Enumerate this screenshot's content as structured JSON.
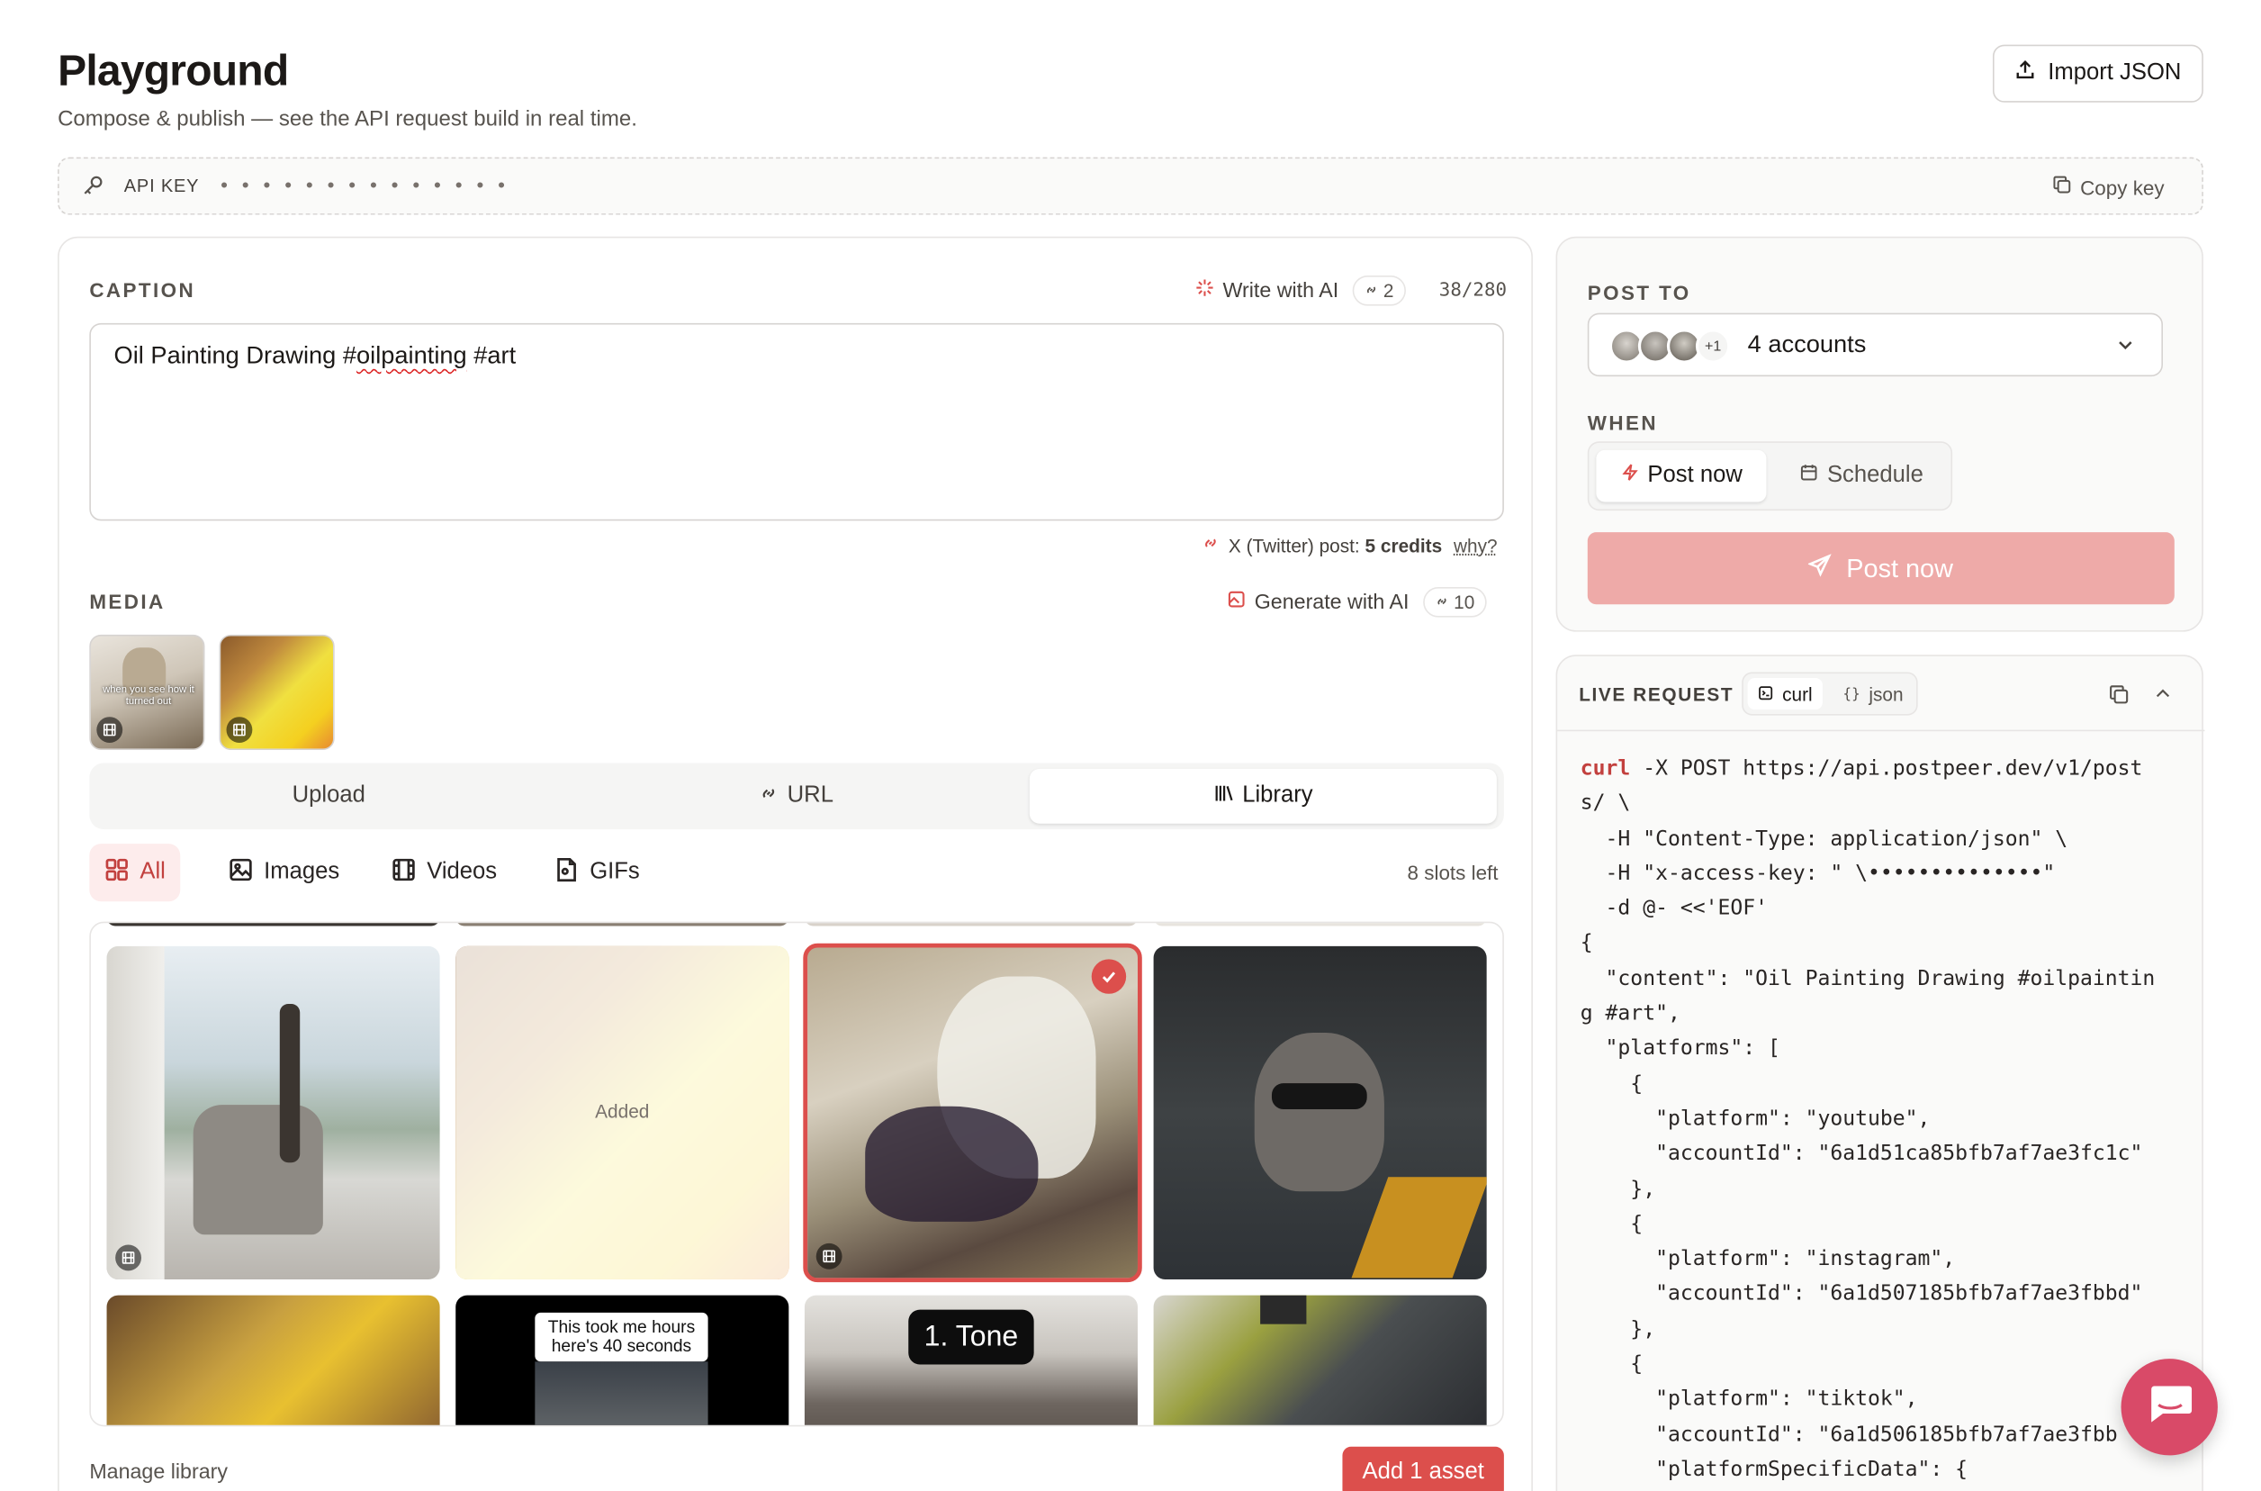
{
  "header": {
    "title": "Playground",
    "subtitle": "Compose & publish — see the API request build in real time.",
    "import_label": "Import JSON"
  },
  "api_key": {
    "label": "API KEY",
    "masked": "• • • • • • • • • • • • • •",
    "copy_label": "Copy key"
  },
  "caption": {
    "section_label": "CAPTION",
    "write_ai_label": "Write with AI",
    "write_ai_credits": "2",
    "char_count": "38/280",
    "text_before": "Oil Painting Drawing #",
    "text_misspelled": "oilpainting",
    "text_after": " #art",
    "cost_prefix": "X (Twitter) post: ",
    "cost_value": "5 credits",
    "why_label": "why?"
  },
  "media": {
    "section_label": "MEDIA",
    "generate_label": "Generate with AI",
    "generate_credits": "10",
    "attached_thumb_caption": "when you see how it turned out",
    "source_tabs": [
      "Upload",
      "URL",
      "Library"
    ],
    "filters": [
      "All",
      "Images",
      "Videos",
      "GIFs"
    ],
    "slots_left": "8 slots left",
    "added_label": "Added",
    "tile_text_1": "This took me hours here's 40 seconds",
    "tile_text_2": "1. Tone",
    "manage_label": "Manage library",
    "add_asset_label": "Add 1 asset"
  },
  "post_to": {
    "section_label": "POST TO",
    "extra_count": "+1",
    "accounts_label": "4 accounts",
    "when_label": "WHEN",
    "post_now_tab": "Post now",
    "schedule_tab": "Schedule",
    "submit_label": "Post now"
  },
  "live_request": {
    "label": "LIVE REQUEST",
    "tab_curl": "curl",
    "tab_json": "json",
    "code_keyword": "curl",
    "code_first_rest": " -X POST https://api.postpeer.dev/v1/post",
    "code_lines": [
      "s/ \\",
      "  -H \"Content-Type: application/json\" \\",
      "  -H \"x-access-key: \" \\••••••••••••••\"",
      "  -d @- <<'EOF'",
      "{",
      "  \"content\": \"Oil Painting Drawing #oilpaintin",
      "g #art\",",
      "  \"platforms\": [",
      "    {",
      "      \"platform\": \"youtube\",",
      "      \"accountId\": \"6a1d51ca85bfb7af7ae3fc1c\"",
      "    },",
      "    {",
      "      \"platform\": \"instagram\",",
      "      \"accountId\": \"6a1d507185bfb7af7ae3fbbd\"",
      "    },",
      "    {",
      "      \"platform\": \"tiktok\",",
      "      \"accountId\": \"6a1d506185bfb7af7ae3fbb",
      "      \"platformSpecificData\": {"
    ]
  },
  "colors": {
    "accent": "#dc4f4c",
    "accent_light": "#eeaaa8",
    "accent_bg": "#fdecec",
    "chat": "#d94a68"
  }
}
